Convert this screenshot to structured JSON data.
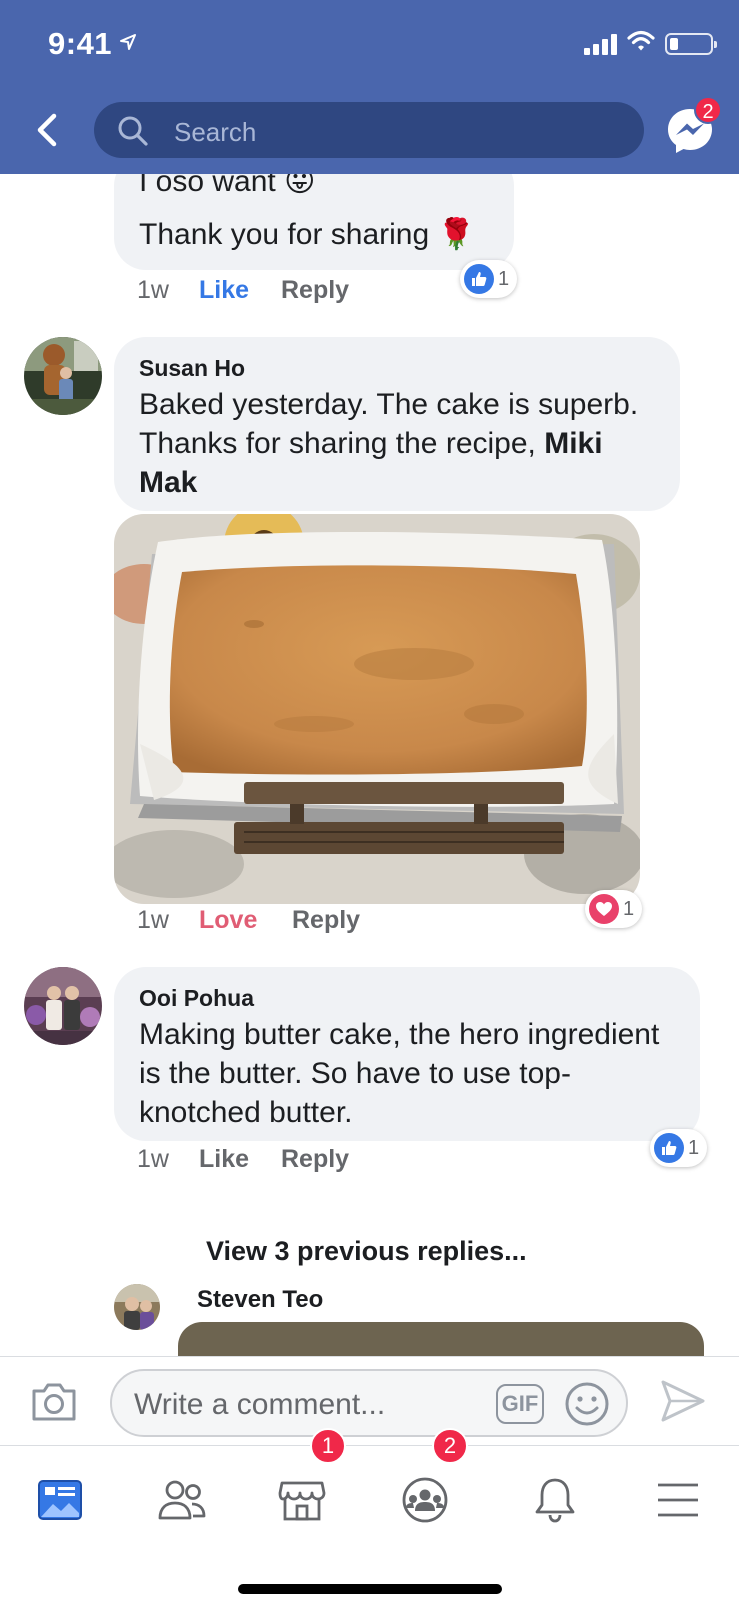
{
  "status_bar": {
    "time": "9:41"
  },
  "header": {
    "search_placeholder": "Search",
    "messenger_badge": "2"
  },
  "comments": [
    {
      "id": "prev",
      "lines": [
        "I oso want 😛",
        "Thank you for sharing 🌹"
      ],
      "time": "1w",
      "reaction_label": "Like",
      "reply_label": "Reply",
      "reaction_count": "1",
      "reaction_type": "like"
    },
    {
      "id": "susan",
      "author": "Susan Ho",
      "text": "Baked yesterday. The cake is superb. Thanks for sharing the recipe, ",
      "mention": "Miki Mak",
      "time": "1w",
      "reaction_label": "Love",
      "reply_label": "Reply",
      "reaction_count": "1",
      "reaction_type": "love"
    },
    {
      "id": "ooi",
      "author": "Ooi Pohua",
      "text": "Making butter cake, the hero ingredient is the butter. So have to use top-knotched butter.",
      "time": "1w",
      "reaction_label": "Like",
      "reply_label": "Reply",
      "reaction_count": "1",
      "reaction_type": "like"
    }
  ],
  "view_previous_replies": "View 3 previous replies...",
  "reply_author": "Steven Teo",
  "composer": {
    "placeholder": "Write a comment...",
    "gif_label": "GIF"
  },
  "tabbar": {
    "marketplace_badge": "1",
    "groups_badge": "2",
    "tabs": [
      "news-feed-icon",
      "friends-icon",
      "marketplace-icon",
      "groups-icon",
      "notifications-icon",
      "menu-icon"
    ]
  },
  "colors": {
    "header": "#4a66ad",
    "search_bar": "#2f4781",
    "like_blue": "#3578e5",
    "love_red": "#e05d74",
    "badge_red": "#f02849",
    "bubble": "#f0f2f5"
  }
}
